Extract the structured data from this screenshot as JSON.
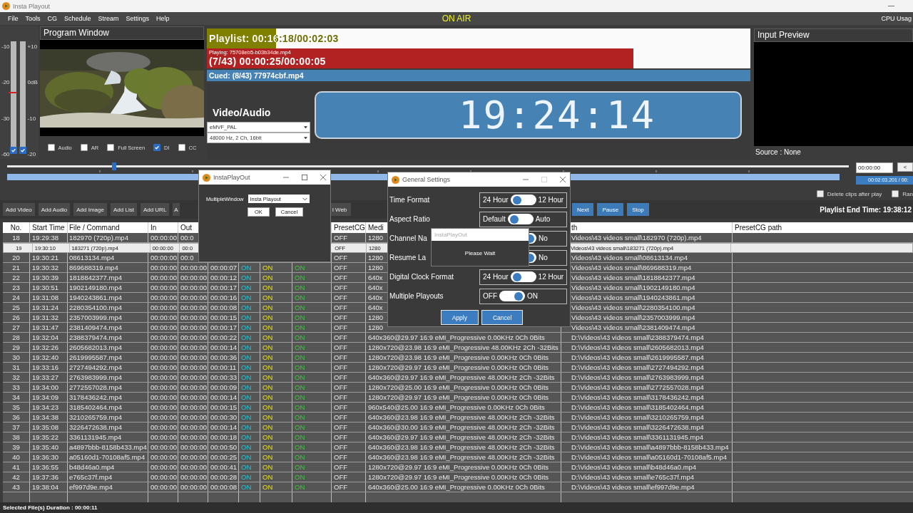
{
  "window": {
    "title": "Insta Playout"
  },
  "menu": [
    "File",
    "Tools",
    "CG",
    "Schedule",
    "Stream",
    "Settings",
    "Help"
  ],
  "on_air": "ON AIR",
  "cpu_usage": "CPU Usag",
  "meters": {
    "left_scale": [
      "-10",
      "-20",
      "-30",
      "-60"
    ],
    "right_scale": [
      "+10",
      "0dB",
      "-10",
      "-20"
    ],
    "channels": [
      {
        "checked": true
      },
      {
        "checked": true
      }
    ]
  },
  "program_window": {
    "title": "Program Window",
    "options": [
      {
        "label": "Audio",
        "checked": false
      },
      {
        "label": "AR",
        "checked": false
      },
      {
        "label": "Full Screen",
        "checked": false
      },
      {
        "label": "DI",
        "checked": true
      },
      {
        "label": "CC",
        "checked": false
      }
    ]
  },
  "playlist": {
    "text": "Playlist: 00:16:18/00:02:03",
    "level": 0.127
  },
  "playing": {
    "file": "Playing: 75708eb5-b03b34de.mp4",
    "time": "(7/43) 00:00:25/00:00:05",
    "level": 0.785
  },
  "cued": "Cued: (8/43) 77974cbf.mp4",
  "video_audio": {
    "title": "Video/Audio",
    "video_format": "eMVF_PAL",
    "audio_format": "48000 Hz, 2 Ch, 16bit"
  },
  "clock": "19:24:14",
  "input_preview": {
    "title": "Input Preview",
    "source": "Source : None"
  },
  "seek": {
    "level": 0.127,
    "time_field": "00:00:00",
    "back_button": "<",
    "duration": "00:02:03.201 / 00:"
  },
  "options": [
    {
      "label": "Delete clips after play",
      "checked": false
    },
    {
      "label": "Ran",
      "checked": false
    }
  ],
  "toolbar": [
    {
      "label": "Add Video",
      "kind": "plain"
    },
    {
      "label": "Add Audio",
      "kind": "plain"
    },
    {
      "label": "Add Image",
      "kind": "plain"
    },
    {
      "label": "Add List",
      "kind": "plain"
    },
    {
      "label": "Add URL",
      "kind": "plain"
    },
    {
      "label": "A",
      "kind": "plain"
    },
    {
      "label": "l Web",
      "kind": "plain"
    },
    {
      "label": "Next",
      "kind": "blue"
    },
    {
      "label": "Pause",
      "kind": "blue"
    },
    {
      "label": "Stop",
      "kind": "blue"
    }
  ],
  "playlist_end_time": "Playlist End Time: 19:38:12",
  "table": {
    "columns": [
      "No.",
      "Start Time",
      "File / Command",
      "In",
      "Out",
      null,
      null,
      null,
      null,
      "PresetCG",
      "Medi",
      "th",
      "PresetCG path"
    ],
    "rows": [
      {
        "selected": false,
        "cells": [
          "18",
          "19:29:38",
          "182970 (720p).mp4",
          "00:00:00",
          "00:0",
          null,
          null,
          null,
          null,
          "OFF",
          "1280",
          "Videos\\43 videos small\\182970 (720p).mp4"
        ]
      },
      {
        "selected": true,
        "cells": [
          "19",
          "19:30:10",
          "183271 (720p).mp4",
          "00:00:00",
          "00:0",
          null,
          null,
          null,
          null,
          "OFF",
          "1280",
          "Videos\\43 videos small\\183271 (720p).mp4"
        ]
      },
      {
        "selected": false,
        "cells": [
          "20",
          "19:30:21",
          "08613134.mp4",
          "00:00:00",
          "00:0",
          null,
          null,
          null,
          null,
          "OFF",
          "1280",
          "Videos\\43 videos small\\08613134.mp4"
        ]
      },
      {
        "selected": false,
        "cells": [
          "21",
          "19:30:32",
          "869688319.mp4",
          "00:00:00",
          "00:00:00",
          "00:00:07",
          "ON",
          "ON",
          "ON",
          "OFF",
          "1280",
          "Videos\\43 videos small\\869688319.mp4"
        ]
      },
      {
        "selected": false,
        "cells": [
          "22",
          "19:30:39",
          "1818842377.mp4",
          "00:00:00",
          "00:00:00",
          "00:00:12",
          "ON",
          "ON",
          "ON",
          "OFF",
          "640x",
          "Videos\\43 videos small\\1818842377.mp4"
        ]
      },
      {
        "selected": false,
        "cells": [
          "23",
          "19:30:51",
          "1902149180.mp4",
          "00:00:00",
          "00:00:00",
          "00:00:17",
          "ON",
          "ON",
          "ON",
          "OFF",
          "640x",
          "Videos\\43 videos small\\1902149180.mp4"
        ]
      },
      {
        "selected": false,
        "cells": [
          "24",
          "19:31:08",
          "1940243861.mp4",
          "00:00:00",
          "00:00:00",
          "00:00:16",
          "ON",
          "ON",
          "ON",
          "OFF",
          "640x",
          "Videos\\43 videos small\\1940243861.mp4"
        ]
      },
      {
        "selected": false,
        "cells": [
          "25",
          "19:31:24",
          "2280354100.mp4",
          "00:00:00",
          "00:00:00",
          "00:00:08",
          "ON",
          "ON",
          "ON",
          "OFF",
          "640x",
          "Videos\\43 videos small\\2280354100.mp4"
        ]
      },
      {
        "selected": false,
        "cells": [
          "26",
          "19:31:32",
          "2357003999.mp4",
          "00:00:00",
          "00:00:00",
          "00:00:15",
          "ON",
          "ON",
          "ON",
          "OFF",
          "1280",
          "Videos\\43 videos small\\2357003999.mp4"
        ]
      },
      {
        "selected": false,
        "cells": [
          "27",
          "19:31:47",
          "2381409474.mp4",
          "00:00:00",
          "00:00:00",
          "00:00:17",
          "ON",
          "ON",
          "ON",
          "OFF",
          "1280",
          "Videos\\43 videos small\\2381409474.mp4"
        ]
      },
      {
        "selected": false,
        "cells": [
          "28",
          "19:32:04",
          "2388379474.mp4",
          "00:00:00",
          "00:00:00",
          "00:00:22",
          "ON",
          "ON",
          "ON",
          "OFF",
          "640x360@29.97 16:9 eMI_Progressive 0.00KHz 0Ch 0Bits",
          "D:\\Videos\\43 videos small\\2388379474.mp4"
        ]
      },
      {
        "selected": false,
        "cells": [
          "29",
          "19:32:26",
          "2605682013.mp4",
          "00:00:00",
          "00:00:00",
          "00:00:14",
          "ON",
          "ON",
          "ON",
          "OFF",
          "1280x720@23.98 16:9 eMI_Progressive 48.00KHz 2Ch -32Bits",
          "D:\\Videos\\43 videos small\\2605682013.mp4"
        ]
      },
      {
        "selected": false,
        "cells": [
          "30",
          "19:32:40",
          "2619995587.mp4",
          "00:00:00",
          "00:00:00",
          "00:00:36",
          "ON",
          "ON",
          "ON",
          "OFF",
          "1280x720@23.98 16:9 eMI_Progressive 0.00KHz 0Ch 0Bits",
          "D:\\Videos\\43 videos small\\2619995587.mp4"
        ]
      },
      {
        "selected": false,
        "cells": [
          "31",
          "19:33:16",
          "2727494292.mp4",
          "00:00:00",
          "00:00:00",
          "00:00:11",
          "ON",
          "ON",
          "ON",
          "OFF",
          "1280x720@29.97 16:9 eMI_Progressive 0.00KHz 0Ch 0Bits",
          "D:\\Videos\\43 videos small\\2727494292.mp4"
        ]
      },
      {
        "selected": false,
        "cells": [
          "32",
          "19:33:27",
          "2763983999.mp4",
          "00:00:00",
          "00:00:00",
          "00:00:33",
          "ON",
          "ON",
          "ON",
          "OFF",
          "640x360@29.97 16:9 eMI_Progressive 48.00KHz 2Ch -32Bits",
          "D:\\Videos\\43 videos small\\2763983999.mp4"
        ]
      },
      {
        "selected": false,
        "cells": [
          "33",
          "19:34:00",
          "2772557028.mp4",
          "00:00:00",
          "00:00:00",
          "00:00:09",
          "ON",
          "ON",
          "ON",
          "OFF",
          "1280x720@25.00 16:9 eMI_Progressive 0.00KHz 0Ch 0Bits",
          "D:\\Videos\\43 videos small\\2772557028.mp4"
        ]
      },
      {
        "selected": false,
        "cells": [
          "34",
          "19:34:09",
          "3178436242.mp4",
          "00:00:00",
          "00:00:00",
          "00:00:14",
          "ON",
          "ON",
          "ON",
          "OFF",
          "1280x720@29.97 16:9 eMI_Progressive 0.00KHz 0Ch 0Bits",
          "D:\\Videos\\43 videos small\\3178436242.mp4"
        ]
      },
      {
        "selected": false,
        "cells": [
          "35",
          "19:34:23",
          "3185402464.mp4",
          "00:00:00",
          "00:00:00",
          "00:00:15",
          "ON",
          "ON",
          "ON",
          "OFF",
          "960x540@25.00 16:9 eMI_Progressive 0.00KHz 0Ch 0Bits",
          "D:\\Videos\\43 videos small\\3185402464.mp4"
        ]
      },
      {
        "selected": false,
        "cells": [
          "36",
          "19:34:38",
          "3210265759.mp4",
          "00:00:00",
          "00:00:00",
          "00:00:30",
          "ON",
          "ON",
          "ON",
          "OFF",
          "640x360@23.98 16:9 eMI_Progressive 48.00KHz 2Ch -32Bits",
          "D:\\Videos\\43 videos small\\3210265759.mp4"
        ]
      },
      {
        "selected": false,
        "cells": [
          "37",
          "19:35:08",
          "3226472638.mp4",
          "00:00:00",
          "00:00:00",
          "00:00:14",
          "ON",
          "ON",
          "ON",
          "OFF",
          "640x360@30.00 16:9 eMI_Progressive 48.00KHz 2Ch -32Bits",
          "D:\\Videos\\43 videos small\\3226472638.mp4"
        ]
      },
      {
        "selected": false,
        "cells": [
          "38",
          "19:35:22",
          "3361131945.mp4",
          "00:00:00",
          "00:00:00",
          "00:00:18",
          "ON",
          "ON",
          "ON",
          "OFF",
          "640x360@29.97 16:9 eMI_Progressive 48.00KHz 2Ch -32Bits",
          "D:\\Videos\\43 videos small\\3361131945.mp4"
        ]
      },
      {
        "selected": false,
        "cells": [
          "39",
          "19:35:40",
          "a4897bbb-8158b433.mp4",
          "00:00:00",
          "00:00:00",
          "00:00:50",
          "ON",
          "ON",
          "ON",
          "OFF",
          "640x360@23.98 16:9 eMI_Progressive 48.00KHz 2Ch -32Bits",
          "D:\\Videos\\43 videos small\\a4897bbb-8158b433.mp4"
        ]
      },
      {
        "selected": false,
        "cells": [
          "40",
          "19:36:30",
          "a05160d1-70108af5.mp4",
          "00:00:00",
          "00:00:00",
          "00:00:25",
          "ON",
          "ON",
          "ON",
          "OFF",
          "640x360@23.98 16:9 eMI_Progressive 48.00KHz 2Ch -32Bits",
          "D:\\Videos\\43 videos small\\a05160d1-70108af5.mp4"
        ]
      },
      {
        "selected": false,
        "cells": [
          "41",
          "19:36:55",
          "b48d46a0.mp4",
          "00:00:00",
          "00:00:00",
          "00:00:41",
          "ON",
          "ON",
          "ON",
          "OFF",
          "1280x720@29.97 16:9 eMI_Progressive 0.00KHz 0Ch 0Bits",
          "D:\\Videos\\43 videos small\\b48d46a0.mp4"
        ]
      },
      {
        "selected": false,
        "cells": [
          "42",
          "19:37:36",
          "e765c37f.mp4",
          "00:00:00",
          "00:00:00",
          "00:00:28",
          "ON",
          "ON",
          "ON",
          "OFF",
          "1280x720@29.97 16:9 eMI_Progressive 0.00KHz 0Ch 0Bits",
          "D:\\Videos\\43 videos small\\e765c37f.mp4"
        ]
      },
      {
        "selected": false,
        "cells": [
          "43",
          "19:38:04",
          "ef997d9e.mp4",
          "00:00:00",
          "00:00:00",
          "00:00:08",
          "ON",
          "ON",
          "ON",
          "OFF",
          "640x360@25.00 16:9 eMI_Progressive 0.00KHz 0Ch 0Bits",
          "D:\\Videos\\43 videos small\\ef997d9e.mp4"
        ]
      }
    ]
  },
  "status_bar": "Selected File(s) Duration : 00:00:11",
  "window_dialog": {
    "title": "InstaPlayOut",
    "label": "MultipleWindow",
    "value": "Insta Playout",
    "buttons": [
      "OK",
      "Cancel"
    ]
  },
  "settings_dialog": {
    "title": "General Settings",
    "settings": [
      {
        "label": "Time Format",
        "off_label": "24 Hour",
        "on_label": "12 Hour",
        "on": false
      },
      {
        "label": "Aspect Ratio",
        "off_label": "Default",
        "on_label": "Auto",
        "on": false
      },
      {
        "label": "Channel Na",
        "on_label": "No",
        "on": true
      },
      {
        "label": "Resume La",
        "on_label": "No",
        "on": true
      },
      {
        "label": "Digital Clock Format",
        "off_label": "24 Hour",
        "on_label": "12 Hour",
        "on": false
      },
      {
        "label": "Multiple Playouts",
        "off_label": "OFF",
        "on_label": "ON",
        "on": true
      }
    ],
    "buttons": [
      "Apply",
      "Cancel"
    ]
  },
  "wait_popup": {
    "title": "InstaPlayOut",
    "message": "Please Wait"
  }
}
